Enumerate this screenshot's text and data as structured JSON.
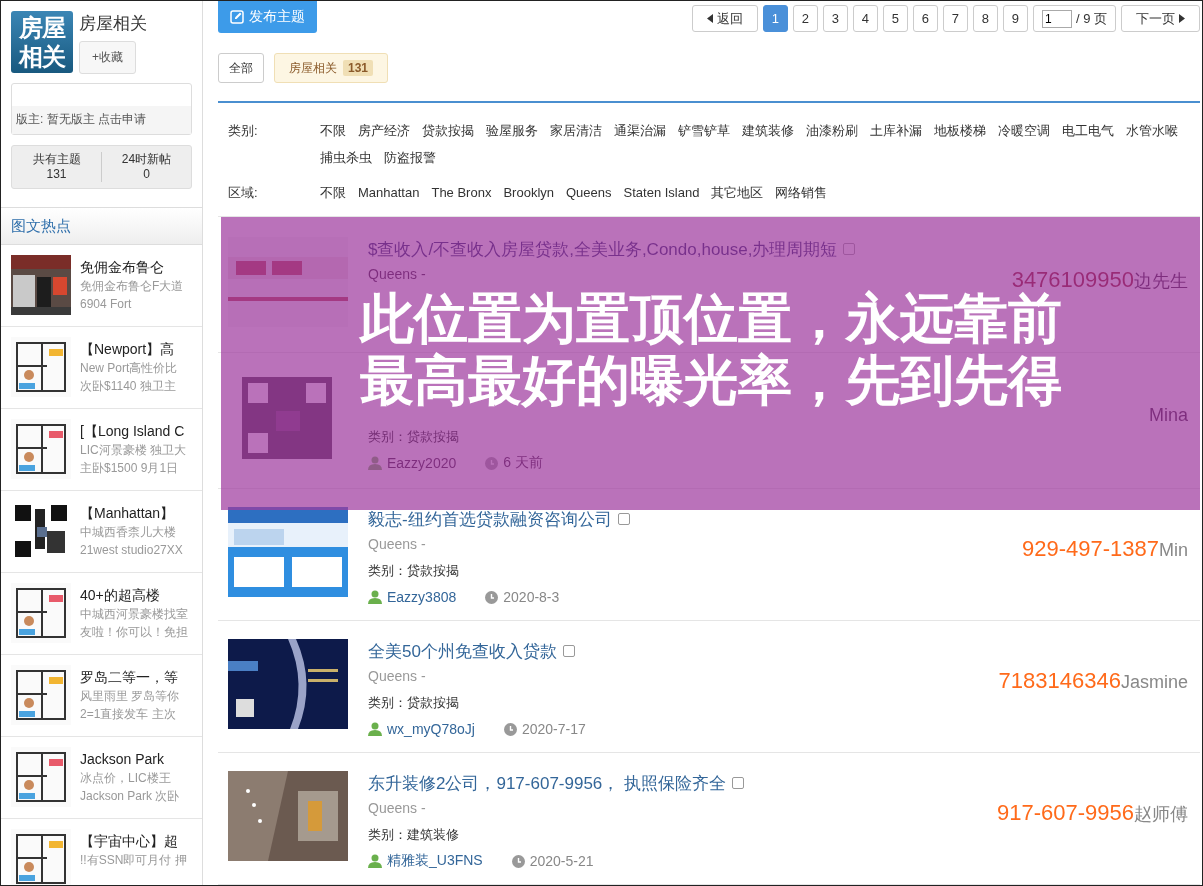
{
  "forum": {
    "logo": [
      "房屋",
      "相关"
    ],
    "title": "房屋相关",
    "favorite_button": "+收藏",
    "moderator_label": "版主:",
    "moderator": "暂无版主",
    "apply_link": "点击申请",
    "stats": [
      {
        "label": "共有主题",
        "value": "131"
      },
      {
        "label": "24时新帖",
        "value": "0"
      }
    ]
  },
  "hot": {
    "title": "图文热点",
    "items": [
      {
        "title": "免佣金布鲁仑",
        "lines": [
          "免佣金布鲁仑F大道",
          "6904 Fort"
        ]
      },
      {
        "title": "【Newport】高",
        "lines": [
          "New Port高性价比",
          "次卧$1140 独卫主"
        ]
      },
      {
        "title": "[【Long Island C",
        "lines": [
          "LIC河景豪楼 独卫大",
          "主卧$1500 9月1日"
        ]
      },
      {
        "title": "【Manhattan】",
        "lines": [
          "中城西香柰儿大楼",
          "21west studio27XX"
        ]
      },
      {
        "title": "40+的超高楼",
        "lines": [
          "中城西河景豪楼找室",
          "友啦！你可以！免担"
        ]
      },
      {
        "title": "罗岛二等一，等",
        "lines": [
          "风里雨里 罗岛等你",
          "2=1直接发车 主次"
        ]
      },
      {
        "title": "Jackson Park",
        "lines": [
          "冰点价，LIC楼王",
          "Jackson Park 次卧"
        ]
      },
      {
        "title": "【宇宙中心】超",
        "lines": [
          "!!有SSN即可月付 押"
        ]
      }
    ]
  },
  "post_button": "发布主题",
  "pagination": {
    "back": "返回",
    "pages": [
      {
        "label": "1",
        "selected": true
      },
      {
        "label": "2",
        "selected": false
      },
      {
        "label": "3",
        "selected": false
      },
      {
        "label": "4",
        "selected": false
      },
      {
        "label": "5",
        "selected": false
      },
      {
        "label": "6",
        "selected": false
      },
      {
        "label": "7",
        "selected": false
      },
      {
        "label": "8",
        "selected": false
      },
      {
        "label": "9",
        "selected": false
      }
    ],
    "page_input": "1",
    "total": "/ 9 页",
    "next": "下一页"
  },
  "tabs": [
    {
      "label": "全部",
      "selected": false
    },
    {
      "label": "房屋相关",
      "count": "131",
      "selected": true
    }
  ],
  "filters": [
    {
      "label": "类别:",
      "options": [
        "不限",
        "房产经济",
        "贷款按揭",
        "验屋服务",
        "家居清洁",
        "通渠治漏",
        "铲雪铲草",
        "建筑装修",
        "油漆粉刷",
        "土库补漏",
        "地板楼梯",
        "冷暖空调",
        "电工电气",
        "水管水喉",
        "捕虫杀虫",
        "防盗报警"
      ]
    },
    {
      "label": "区域:",
      "options": [
        "不限",
        "Manhattan",
        "The Bronx",
        "Brooklyn",
        "Queens",
        "Staten Island",
        "其它地区",
        "网络销售"
      ]
    }
  ],
  "threads": [
    {
      "title": "$查收入/不查收入房屋贷款,全美业务,Condo,house,办理周期短",
      "checked": false,
      "location": "Queens -",
      "phone": "3476109950",
      "contact": "边先生"
    },
    {
      "category": "类别：贷款按揭",
      "user": "Eazzy2020",
      "time": "6 天前",
      "contact": "Mina"
    },
    {
      "title": "毅志-纽约首选贷款融资咨询公司",
      "checked": false,
      "location": "Queens -",
      "category": "类别：贷款按揭",
      "user": "Eazzy3808",
      "time": "2020-8-3",
      "phone": "929-497-1387",
      "contact": "Min"
    },
    {
      "title": "全美50个州免查收入贷款",
      "checked": false,
      "location": "Queens -",
      "category": "类别：贷款按揭",
      "user": "wx_myQ78oJj",
      "time": "2020-7-17",
      "phone": "7183146346",
      "contact": "Jasmine"
    },
    {
      "title": "东升装修2公司，917-607-9956， 执照保险齐全",
      "checked": false,
      "location": "Queens -",
      "category": "类别：建筑装修",
      "user": "精雅装_U3FNS",
      "time": "2020-5-21",
      "phone": "917-607-9956",
      "contact": "赵师傅"
    }
  ],
  "promo_overlay": [
    "此位置为置顶位置，永远靠前",
    "最高最好的曝光率，先到先得"
  ]
}
